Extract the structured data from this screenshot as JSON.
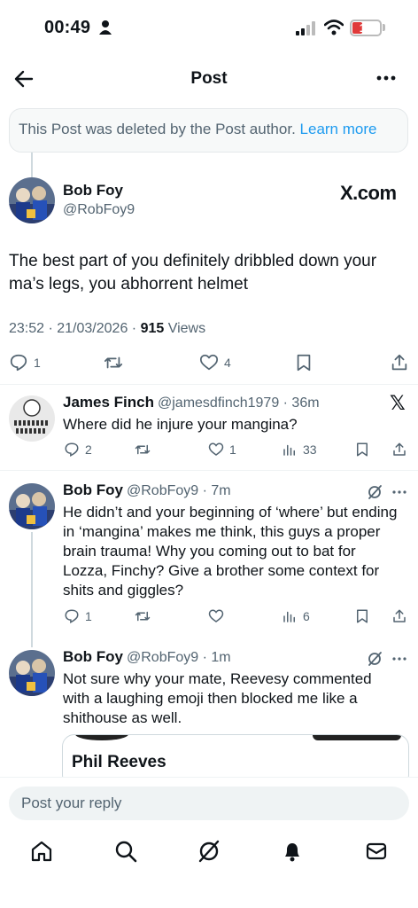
{
  "status_bar": {
    "time": "00:49",
    "battery": "10"
  },
  "header": {
    "title": "Post"
  },
  "deleted_notice": {
    "text": "This Post was deleted by the Post author.",
    "link": "Learn more"
  },
  "main_post": {
    "name": "Bob Foy",
    "handle": "@RobFoy9",
    "brand": "X.com",
    "text": "The best part of you definitely dribbled down your ma’s legs, you abhorrent helmet",
    "timestamp": "23:52 · 21/03/2026 · ",
    "views_count": "915",
    "views_label": " Views",
    "replies": "1",
    "likes": "4"
  },
  "replies": [
    {
      "name": "James Finch",
      "meta": "@jamesdfinch1979 · 36m",
      "text": "Where did he injure your mangina?",
      "reply_count": "2",
      "like_count": "1",
      "views": "33"
    },
    {
      "name": "Bob Foy",
      "meta": "@RobFoy9 · 7m",
      "text": "He didn’t and your beginning of ‘where’ but ending in ‘mangina’ makes me think, this guys a proper brain trauma! Why you coming out to bat for Lozza, Finchy? Give a brother some context for shits and giggles?",
      "reply_count": "1",
      "views": "6"
    },
    {
      "name": "Bob Foy",
      "meta": "@RobFoy9 · 1m",
      "text": "Not sure why your mate, Reevesy commented with a laughing emoji then blocked me like a shithouse as well.",
      "card_name": "Phil Reeves"
    }
  ],
  "reply_bar": {
    "placeholder": "Post your reply"
  },
  "colors": {
    "accent": "#1d9bf0",
    "muted": "#536471",
    "battery_low": "#e03a3a"
  },
  "icons": [
    "back-arrow-icon",
    "more-icon",
    "reply-icon",
    "repost-icon",
    "like-icon",
    "bookmark-icon",
    "share-icon",
    "views-icon",
    "grok-icon",
    "home-icon",
    "search-icon",
    "notifications-icon",
    "messages-icon"
  ]
}
